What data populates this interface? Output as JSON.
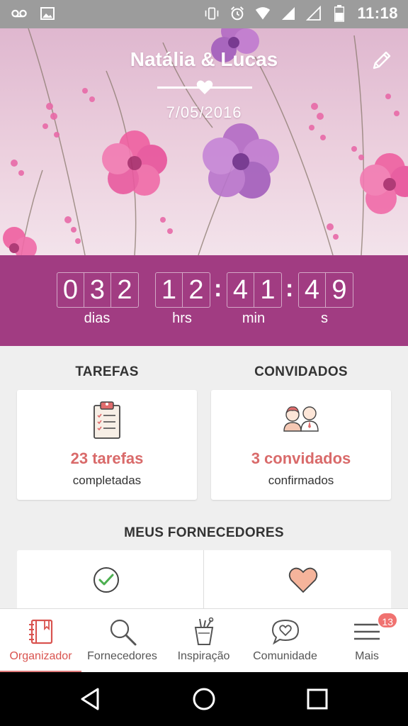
{
  "status_bar": {
    "time": "11:18",
    "left_icons": [
      "voicemail-icon",
      "image-icon"
    ],
    "right_icons": [
      "vibrate-icon",
      "alarm-icon",
      "wifi-icon",
      "signal-icon",
      "signal-empty-icon",
      "battery-icon"
    ]
  },
  "header": {
    "couple_name": "Natália & Lucas",
    "wedding_date": "7/05/2016",
    "edit_icon": "pencil-icon"
  },
  "countdown": {
    "days": [
      "0",
      "3",
      "2"
    ],
    "hours": [
      "1",
      "2"
    ],
    "minutes": [
      "4",
      "1"
    ],
    "seconds": [
      "4",
      "9"
    ],
    "separator": ":",
    "labels": {
      "days": "dias",
      "hours": "hrs",
      "minutes": "min",
      "seconds": "s"
    }
  },
  "tasks": {
    "title": "TAREFAS",
    "stat": "23 tarefas",
    "sub": "completadas",
    "icon": "clipboard-icon"
  },
  "guests": {
    "title": "CONVIDADOS",
    "stat": "3 convidados",
    "sub": "confirmados",
    "icon": "guests-icon"
  },
  "suppliers": {
    "title": "MEUS FORNECEDORES",
    "left_icon": "check-circle-icon",
    "right_icon": "heart-icon"
  },
  "bottom_nav": {
    "items": [
      {
        "label": "Organizador",
        "icon": "notebook-icon",
        "active": true
      },
      {
        "label": "Fornecedores",
        "icon": "search-icon",
        "active": false
      },
      {
        "label": "Inspiração",
        "icon": "cup-icon",
        "active": false
      },
      {
        "label": "Comunidade",
        "icon": "chat-heart-icon",
        "active": false
      },
      {
        "label": "Mais",
        "icon": "menu-icon",
        "active": false
      }
    ],
    "more_badge": "13"
  },
  "colors": {
    "countdown_bg": "#a13c82",
    "accent": "#d96a6a",
    "active_nav": "#d9534f"
  }
}
